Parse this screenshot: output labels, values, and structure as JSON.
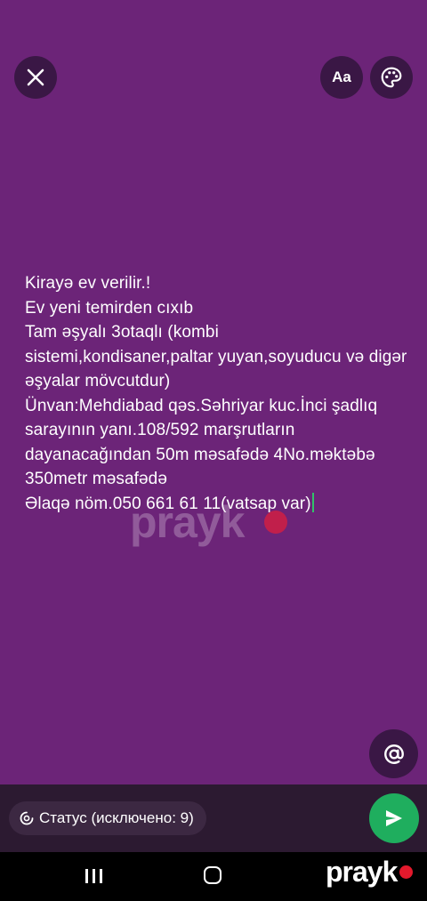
{
  "toolbar": {
    "close_icon": "close-icon",
    "font_label": "Aa",
    "palette_icon": "palette-icon"
  },
  "status": {
    "text": "Kirayə ev verilir.!\nEv yeni temirden cıxıb\nTam əşyalı 3otaqlı (kombi sistemi,kondisaner,paltar yuyan,soyuducu və digər əşyalar mövcutdur)\nÜnvan:Mehdiabad qəs.Səhriyar kuc.İnci şadlıq sarayının yanı.108/592 marşrutların dayanacağından 50m məsafədə 4No.məktəbə 350metr məsafədə\nƏlaqə nöm.050 661 61 11(vatsap var)"
  },
  "watermark": "prayk",
  "mention_icon": "at-icon",
  "audience": {
    "label": "Статус (исключено: 9)",
    "icon": "status-icon"
  },
  "send_icon": "send-icon",
  "nav": {
    "recents_icon": "recents-icon",
    "home_icon": "home-icon"
  },
  "logo": "prayk",
  "colors": {
    "background": "#6c2478",
    "button": "#3a1745",
    "send": "#1fae5e",
    "cursor": "#32c26a",
    "logo_dot": "#e3192c"
  }
}
